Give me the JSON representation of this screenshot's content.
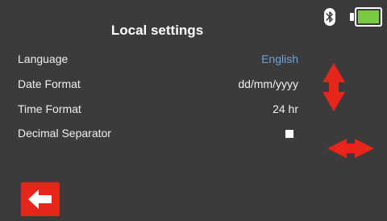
{
  "header": {
    "title": "Local settings"
  },
  "status": {
    "bluetooth_icon": "bluetooth-icon",
    "battery_icon": "battery-icon",
    "battery_level": 1.0,
    "battery_color": "#7ac943"
  },
  "settings": [
    {
      "label": "Language",
      "value": "English",
      "selected": true
    },
    {
      "label": "Date Format",
      "value": "dd/mm/yyyy"
    },
    {
      "label": "Time Format",
      "value": "24 hr"
    },
    {
      "label": "Decimal Separator",
      "value": "",
      "checkbox": true
    }
  ],
  "controls": {
    "up_down_icon": "up-down-arrow-icon",
    "left_right_icon": "left-right-arrow-icon",
    "back_icon": "back-arrow-icon",
    "accent_color": "#e8251b",
    "selected_text_color": "#6fa3d6"
  }
}
